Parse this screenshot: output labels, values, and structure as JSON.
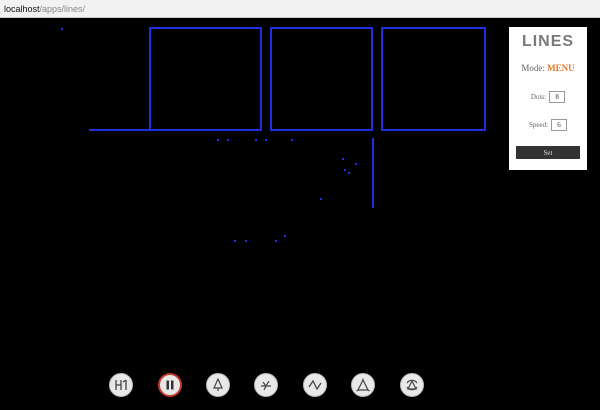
{
  "browser": {
    "url_host": "localhost",
    "url_path": "/apps/lines/"
  },
  "panel": {
    "title": "LINES",
    "mode_label": "Mode:",
    "mode_value": "MENU",
    "dots_label": "Dots:",
    "dots_value": "8",
    "speed_label": "Speed:",
    "speed_value": "6",
    "set_label": "Set"
  },
  "colors": {
    "line": "#1f2fe0",
    "panel_bg": "#ffffff",
    "mode_accent": "#e07a2d",
    "active_ring": "#c0392b"
  },
  "toolbar": {
    "items": [
      {
        "name": "reset-icon",
        "active": false
      },
      {
        "name": "pause-icon",
        "active": true
      },
      {
        "name": "tree-icon",
        "active": false
      },
      {
        "name": "star-icon",
        "active": false
      },
      {
        "name": "wave-icon",
        "active": false
      },
      {
        "name": "triangle-icon",
        "active": false
      },
      {
        "name": "cycle-icon",
        "active": false
      }
    ]
  }
}
